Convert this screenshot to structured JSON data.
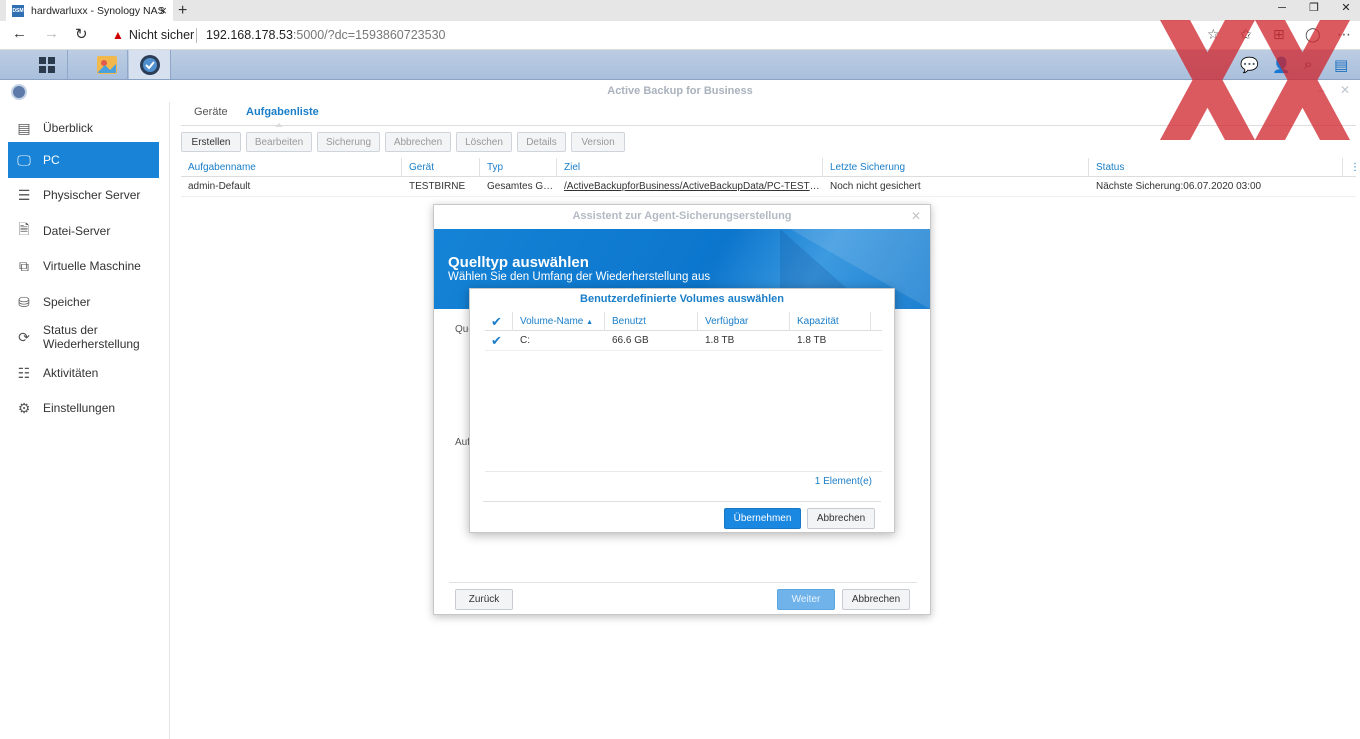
{
  "browser": {
    "tab_title": "hardwarluxx - Synology NAS",
    "favicon_text": "DSM",
    "new_tab": "+",
    "security_label": "Nicht sicher",
    "url_host": "192.168.178.53",
    "url_rest": ":5000/?dc=1593860723530",
    "window_controls": [
      "─",
      "❐",
      "✕"
    ]
  },
  "app": {
    "title": "Active Backup for Business"
  },
  "sidebar": {
    "items": [
      {
        "label": "Überblick",
        "icon": "overview-icon"
      },
      {
        "label": "PC",
        "icon": "pc-icon"
      },
      {
        "label": "Physischer Server",
        "icon": "server-icon"
      },
      {
        "label": "Datei-Server",
        "icon": "file-server-icon"
      },
      {
        "label": "Virtuelle Maschine",
        "icon": "virtual-machine-icon"
      },
      {
        "label": "Speicher",
        "icon": "storage-icon"
      },
      {
        "label": "Status der Wiederherstellung",
        "label_line1": "Status der",
        "label_line2": "Wiederherstellung",
        "icon": "restore-status-icon"
      },
      {
        "label": "Aktivitäten",
        "icon": "activities-icon"
      },
      {
        "label": "Einstellungen",
        "icon": "settings-icon"
      }
    ],
    "active_index": 1
  },
  "content": {
    "tabs": [
      "Geräte",
      "Aufgabenliste"
    ],
    "active_tab": "Aufgabenliste",
    "toolbar": [
      "Erstellen",
      "Bearbeiten",
      "Sicherung",
      "Abbrechen",
      "Löschen",
      "Details",
      "Version"
    ],
    "columns": [
      "Aufgabenname",
      "Gerät",
      "Typ",
      "Ziel",
      "Letzte Sicherung",
      "Status"
    ],
    "rows": [
      {
        "name": "admin-Default",
        "device": "TESTBIRNE",
        "type": "Gesamtes Ge...",
        "target": "/ActiveBackupforBusiness/ActiveBackupData/PC-TESTBI...",
        "last_backup": "Noch nicht gesichert",
        "status": "Nächste Sicherung:06.07.2020 03:00"
      }
    ]
  },
  "wizard": {
    "title": "Assistent zur Agent-Sicherungserstellung",
    "heading": "Quelltyp auswählen",
    "subheading": "Wählen Sie den Umfang der Wiederherstellung aus",
    "label_1": "Que",
    "label_2": "Auf",
    "back_label": "Zurück",
    "next_label": "Weiter",
    "cancel_label": "Abbrechen"
  },
  "volume_dialog": {
    "title": "Benutzerdefinierte Volumes auswählen",
    "columns": [
      "Volume-Name",
      "Benutzt",
      "Verfügbar",
      "Kapazität"
    ],
    "rows": [
      {
        "checked": true,
        "name": "C:",
        "used": "66.6 GB",
        "available": "1.8 TB",
        "capacity": "1.8 TB"
      }
    ],
    "count": "1 Element(e)",
    "apply_label": "Übernehmen",
    "cancel_label": "Abbrechen"
  },
  "colors": {
    "accent": "#1883d7",
    "watermark": "#d0232b"
  }
}
